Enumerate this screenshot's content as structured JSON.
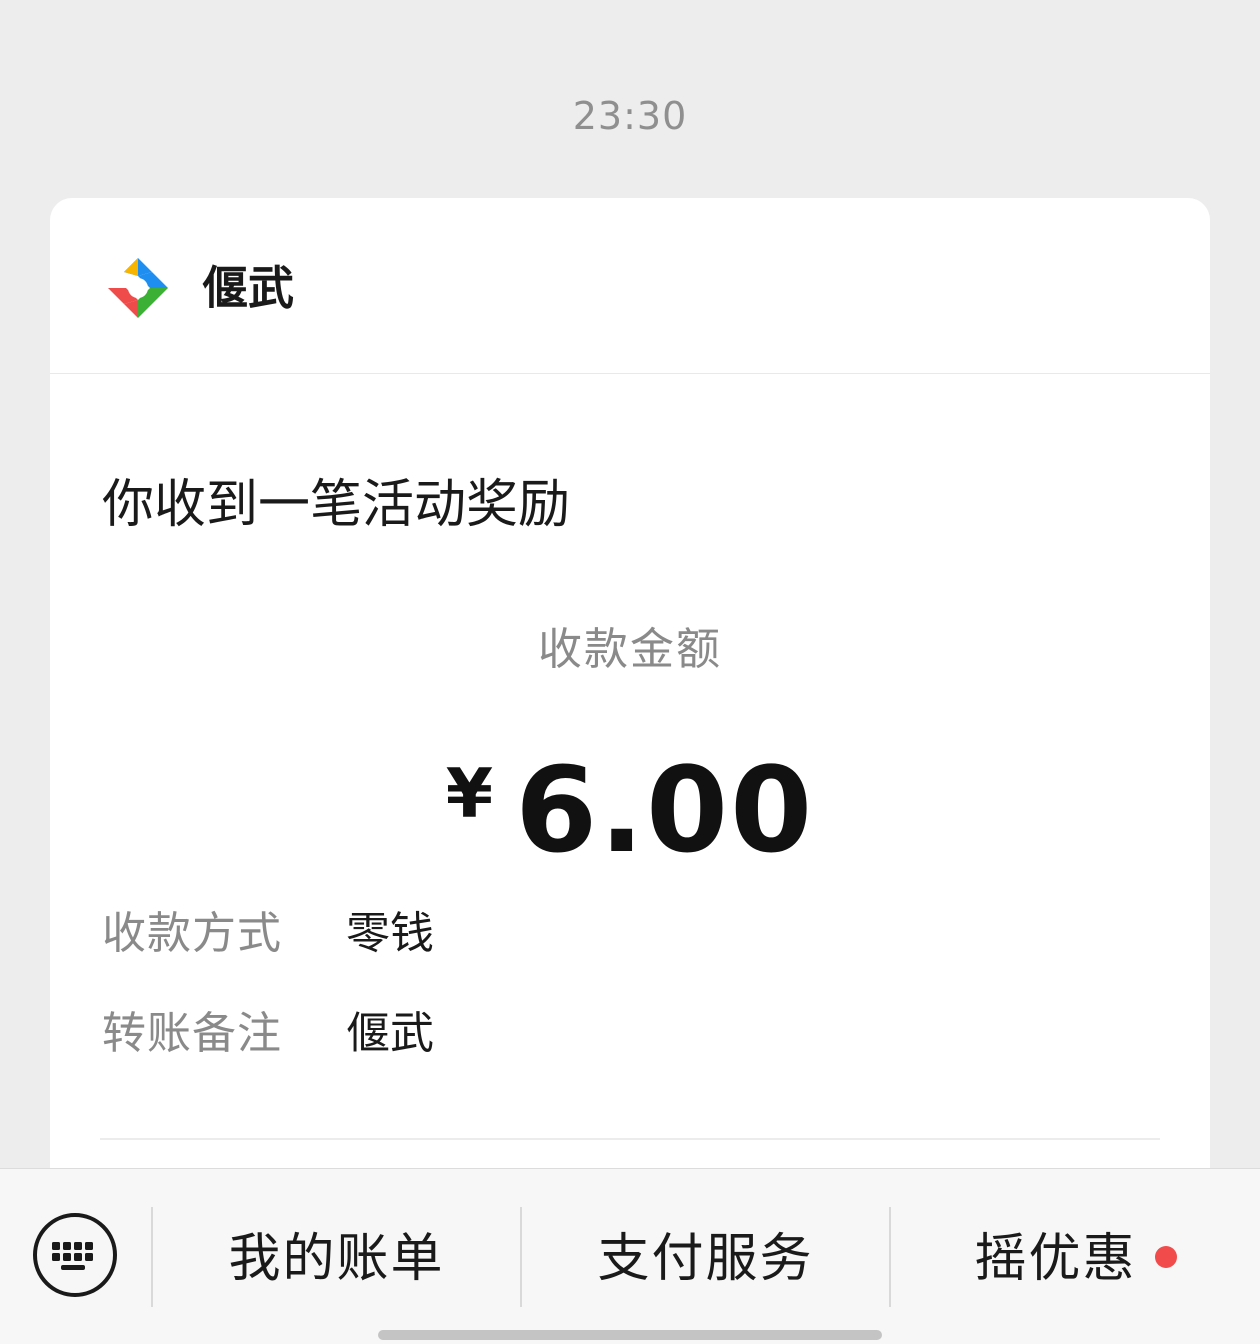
{
  "timestamp": "23:30",
  "card": {
    "sender_name": "偃武",
    "headline": "你收到一笔活动奖励",
    "amount_label": "收款金额",
    "currency_symbol": "¥",
    "amount": "6.00",
    "details": [
      {
        "label": "收款方式",
        "value": "零钱"
      },
      {
        "label": "转账备注",
        "value": "偃武"
      }
    ]
  },
  "bottom_bar": {
    "keyboard_icon": "keyboard-icon",
    "menus": [
      {
        "label": "我的账单"
      },
      {
        "label": "支付服务"
      },
      {
        "label": "摇优惠",
        "has_badge": true
      }
    ]
  },
  "colors": {
    "background": "#ededed",
    "card": "#ffffff",
    "badge": "#f24b4b",
    "logo_yellow": "#f7b500",
    "logo_blue": "#1f8ef1",
    "logo_green": "#3cb034",
    "logo_red": "#ef4b4b"
  }
}
